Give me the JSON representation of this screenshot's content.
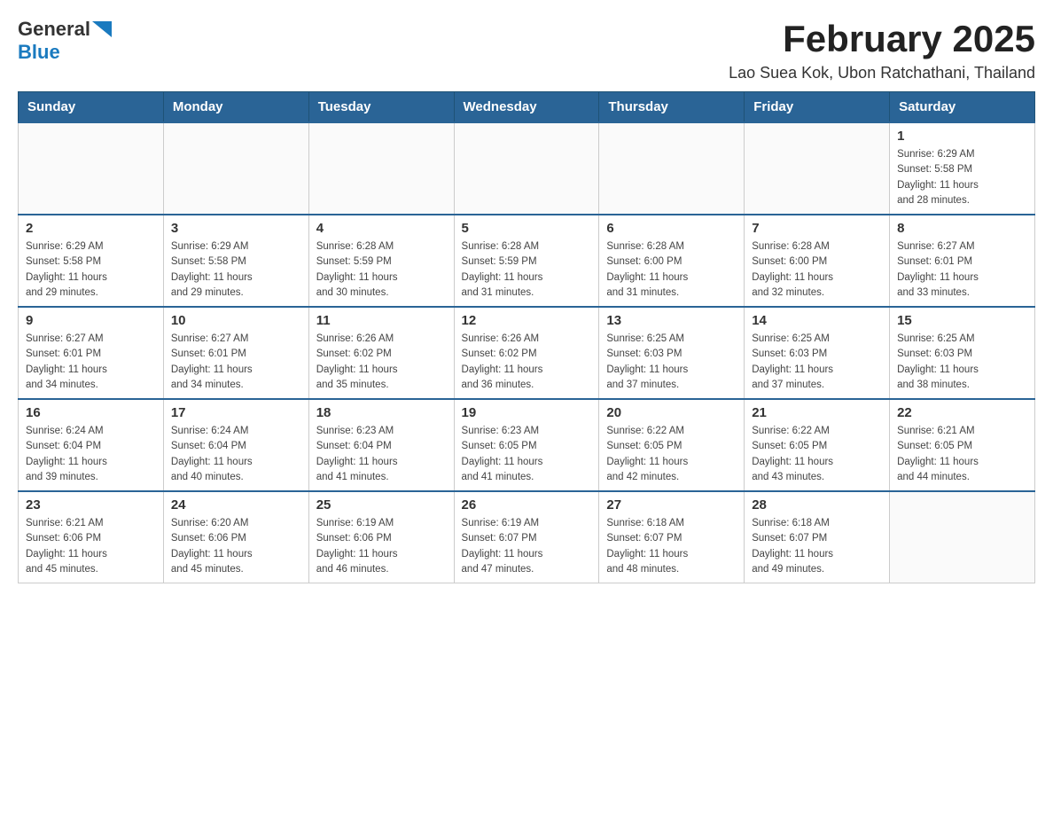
{
  "header": {
    "logo": {
      "general": "General",
      "triangle": "▶",
      "blue": "Blue"
    },
    "title": "February 2025",
    "location": "Lao Suea Kok, Ubon Ratchathani, Thailand"
  },
  "days_of_week": [
    "Sunday",
    "Monday",
    "Tuesday",
    "Wednesday",
    "Thursday",
    "Friday",
    "Saturday"
  ],
  "weeks": [
    {
      "cells": [
        {
          "day": "",
          "info": ""
        },
        {
          "day": "",
          "info": ""
        },
        {
          "day": "",
          "info": ""
        },
        {
          "day": "",
          "info": ""
        },
        {
          "day": "",
          "info": ""
        },
        {
          "day": "",
          "info": ""
        },
        {
          "day": "1",
          "info": "Sunrise: 6:29 AM\nSunset: 5:58 PM\nDaylight: 11 hours\nand 28 minutes."
        }
      ]
    },
    {
      "cells": [
        {
          "day": "2",
          "info": "Sunrise: 6:29 AM\nSunset: 5:58 PM\nDaylight: 11 hours\nand 29 minutes."
        },
        {
          "day": "3",
          "info": "Sunrise: 6:29 AM\nSunset: 5:58 PM\nDaylight: 11 hours\nand 29 minutes."
        },
        {
          "day": "4",
          "info": "Sunrise: 6:28 AM\nSunset: 5:59 PM\nDaylight: 11 hours\nand 30 minutes."
        },
        {
          "day": "5",
          "info": "Sunrise: 6:28 AM\nSunset: 5:59 PM\nDaylight: 11 hours\nand 31 minutes."
        },
        {
          "day": "6",
          "info": "Sunrise: 6:28 AM\nSunset: 6:00 PM\nDaylight: 11 hours\nand 31 minutes."
        },
        {
          "day": "7",
          "info": "Sunrise: 6:28 AM\nSunset: 6:00 PM\nDaylight: 11 hours\nand 32 minutes."
        },
        {
          "day": "8",
          "info": "Sunrise: 6:27 AM\nSunset: 6:01 PM\nDaylight: 11 hours\nand 33 minutes."
        }
      ]
    },
    {
      "cells": [
        {
          "day": "9",
          "info": "Sunrise: 6:27 AM\nSunset: 6:01 PM\nDaylight: 11 hours\nand 34 minutes."
        },
        {
          "day": "10",
          "info": "Sunrise: 6:27 AM\nSunset: 6:01 PM\nDaylight: 11 hours\nand 34 minutes."
        },
        {
          "day": "11",
          "info": "Sunrise: 6:26 AM\nSunset: 6:02 PM\nDaylight: 11 hours\nand 35 minutes."
        },
        {
          "day": "12",
          "info": "Sunrise: 6:26 AM\nSunset: 6:02 PM\nDaylight: 11 hours\nand 36 minutes."
        },
        {
          "day": "13",
          "info": "Sunrise: 6:25 AM\nSunset: 6:03 PM\nDaylight: 11 hours\nand 37 minutes."
        },
        {
          "day": "14",
          "info": "Sunrise: 6:25 AM\nSunset: 6:03 PM\nDaylight: 11 hours\nand 37 minutes."
        },
        {
          "day": "15",
          "info": "Sunrise: 6:25 AM\nSunset: 6:03 PM\nDaylight: 11 hours\nand 38 minutes."
        }
      ]
    },
    {
      "cells": [
        {
          "day": "16",
          "info": "Sunrise: 6:24 AM\nSunset: 6:04 PM\nDaylight: 11 hours\nand 39 minutes."
        },
        {
          "day": "17",
          "info": "Sunrise: 6:24 AM\nSunset: 6:04 PM\nDaylight: 11 hours\nand 40 minutes."
        },
        {
          "day": "18",
          "info": "Sunrise: 6:23 AM\nSunset: 6:04 PM\nDaylight: 11 hours\nand 41 minutes."
        },
        {
          "day": "19",
          "info": "Sunrise: 6:23 AM\nSunset: 6:05 PM\nDaylight: 11 hours\nand 41 minutes."
        },
        {
          "day": "20",
          "info": "Sunrise: 6:22 AM\nSunset: 6:05 PM\nDaylight: 11 hours\nand 42 minutes."
        },
        {
          "day": "21",
          "info": "Sunrise: 6:22 AM\nSunset: 6:05 PM\nDaylight: 11 hours\nand 43 minutes."
        },
        {
          "day": "22",
          "info": "Sunrise: 6:21 AM\nSunset: 6:05 PM\nDaylight: 11 hours\nand 44 minutes."
        }
      ]
    },
    {
      "cells": [
        {
          "day": "23",
          "info": "Sunrise: 6:21 AM\nSunset: 6:06 PM\nDaylight: 11 hours\nand 45 minutes."
        },
        {
          "day": "24",
          "info": "Sunrise: 6:20 AM\nSunset: 6:06 PM\nDaylight: 11 hours\nand 45 minutes."
        },
        {
          "day": "25",
          "info": "Sunrise: 6:19 AM\nSunset: 6:06 PM\nDaylight: 11 hours\nand 46 minutes."
        },
        {
          "day": "26",
          "info": "Sunrise: 6:19 AM\nSunset: 6:07 PM\nDaylight: 11 hours\nand 47 minutes."
        },
        {
          "day": "27",
          "info": "Sunrise: 6:18 AM\nSunset: 6:07 PM\nDaylight: 11 hours\nand 48 minutes."
        },
        {
          "day": "28",
          "info": "Sunrise: 6:18 AM\nSunset: 6:07 PM\nDaylight: 11 hours\nand 49 minutes."
        },
        {
          "day": "",
          "info": ""
        }
      ]
    }
  ]
}
